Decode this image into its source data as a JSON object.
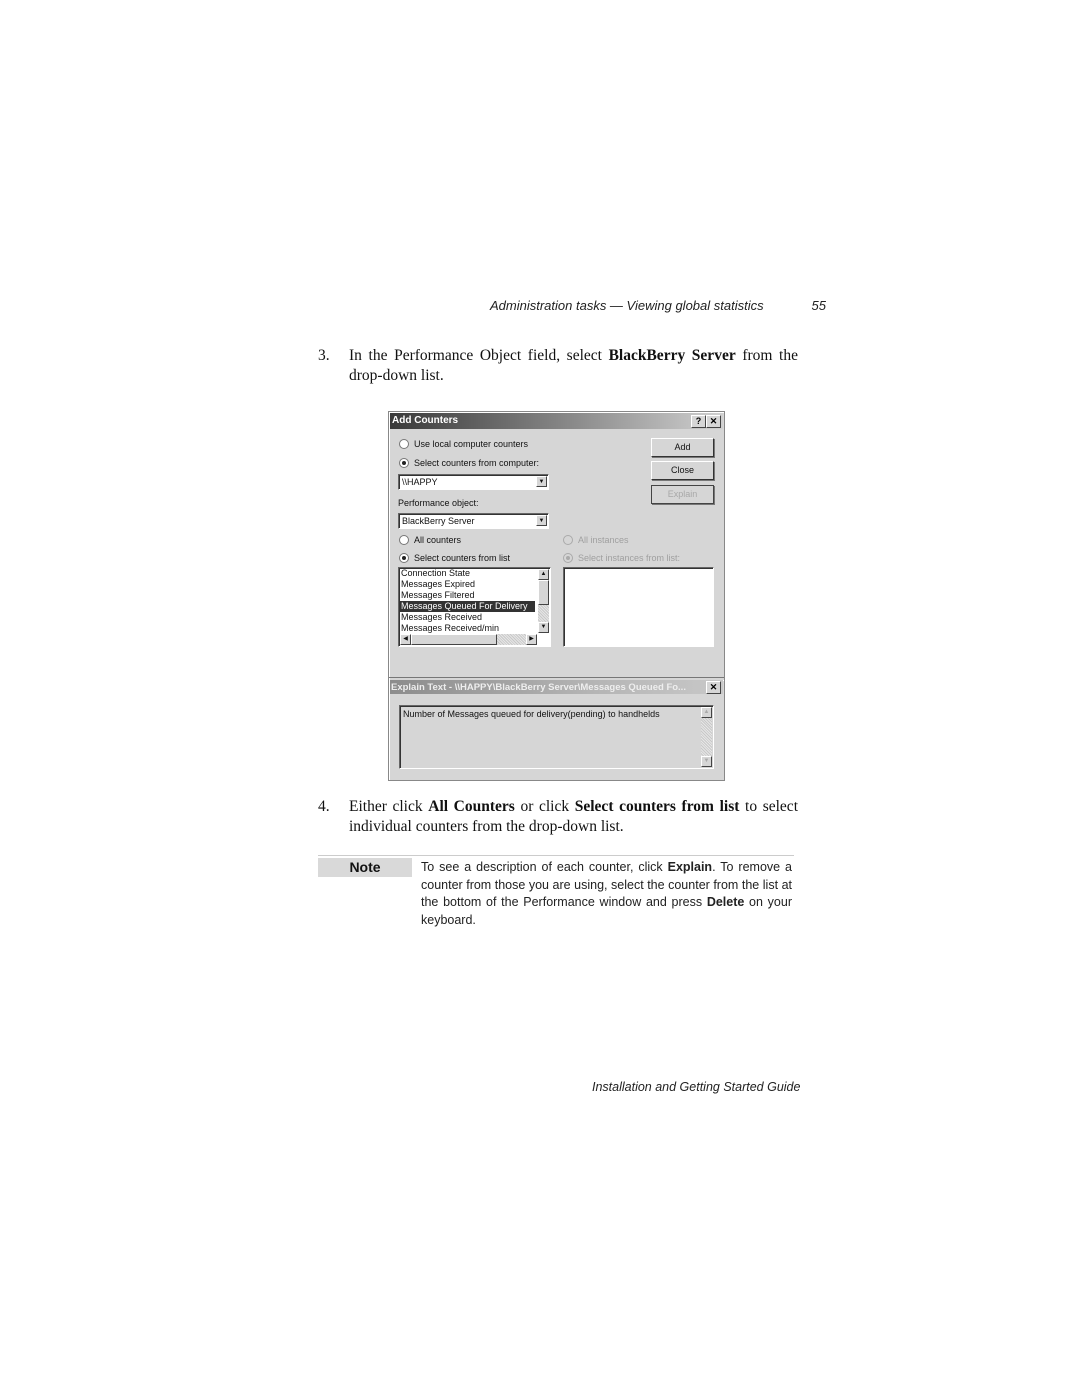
{
  "header": {
    "running_title": "Administration tasks  —  Viewing global statistics",
    "page_number": "55"
  },
  "steps": [
    {
      "number": "3.",
      "parts": [
        "In the Performance Object field, select ",
        "BlackBerry Server",
        " from the drop-down list."
      ]
    },
    {
      "number": "4.",
      "parts": [
        "Either click ",
        "All Counters",
        " or click ",
        "Select counters from list",
        " to select individual counters from the drop-down list."
      ]
    }
  ],
  "dialog": {
    "title": "Add Counters",
    "help_button": "?",
    "close_button": "✕",
    "radio_local": "Use local computer counters",
    "radio_select_computer": "Select counters from computer:",
    "computer_value": "\\\\HAPPY",
    "performance_object_label": "Performance object:",
    "performance_object_value": "BlackBerry Server",
    "radio_all_counters": "All counters",
    "radio_select_counters": "Select counters from list",
    "radio_all_instances": "All instances",
    "radio_select_instances": "Select instances from list:",
    "buttons": {
      "add": "Add",
      "close": "Close",
      "explain": "Explain"
    },
    "counters": [
      "Connection State",
      "Messages Expired",
      "Messages Filtered",
      "Messages Queued For Delivery",
      "Messages Received",
      "Messages Received/min"
    ],
    "selected_counter": "Messages Queued For Delivery",
    "explain_title": "Explain Text - \\\\HAPPY\\BlackBerry Server\\Messages Queued Fo...",
    "explain_text": "Number of Messages queued for delivery(pending) to handhelds"
  },
  "note": {
    "label": "Note",
    "parts": [
      "To see a description of each counter, click ",
      "Explain",
      ". To remove a counter from those you are using, select the counter from the list at the bottom of the Performance window and press ",
      "Delete",
      " on your keyboard."
    ]
  },
  "footer": {
    "text": "Installation and Getting Started Guide"
  }
}
